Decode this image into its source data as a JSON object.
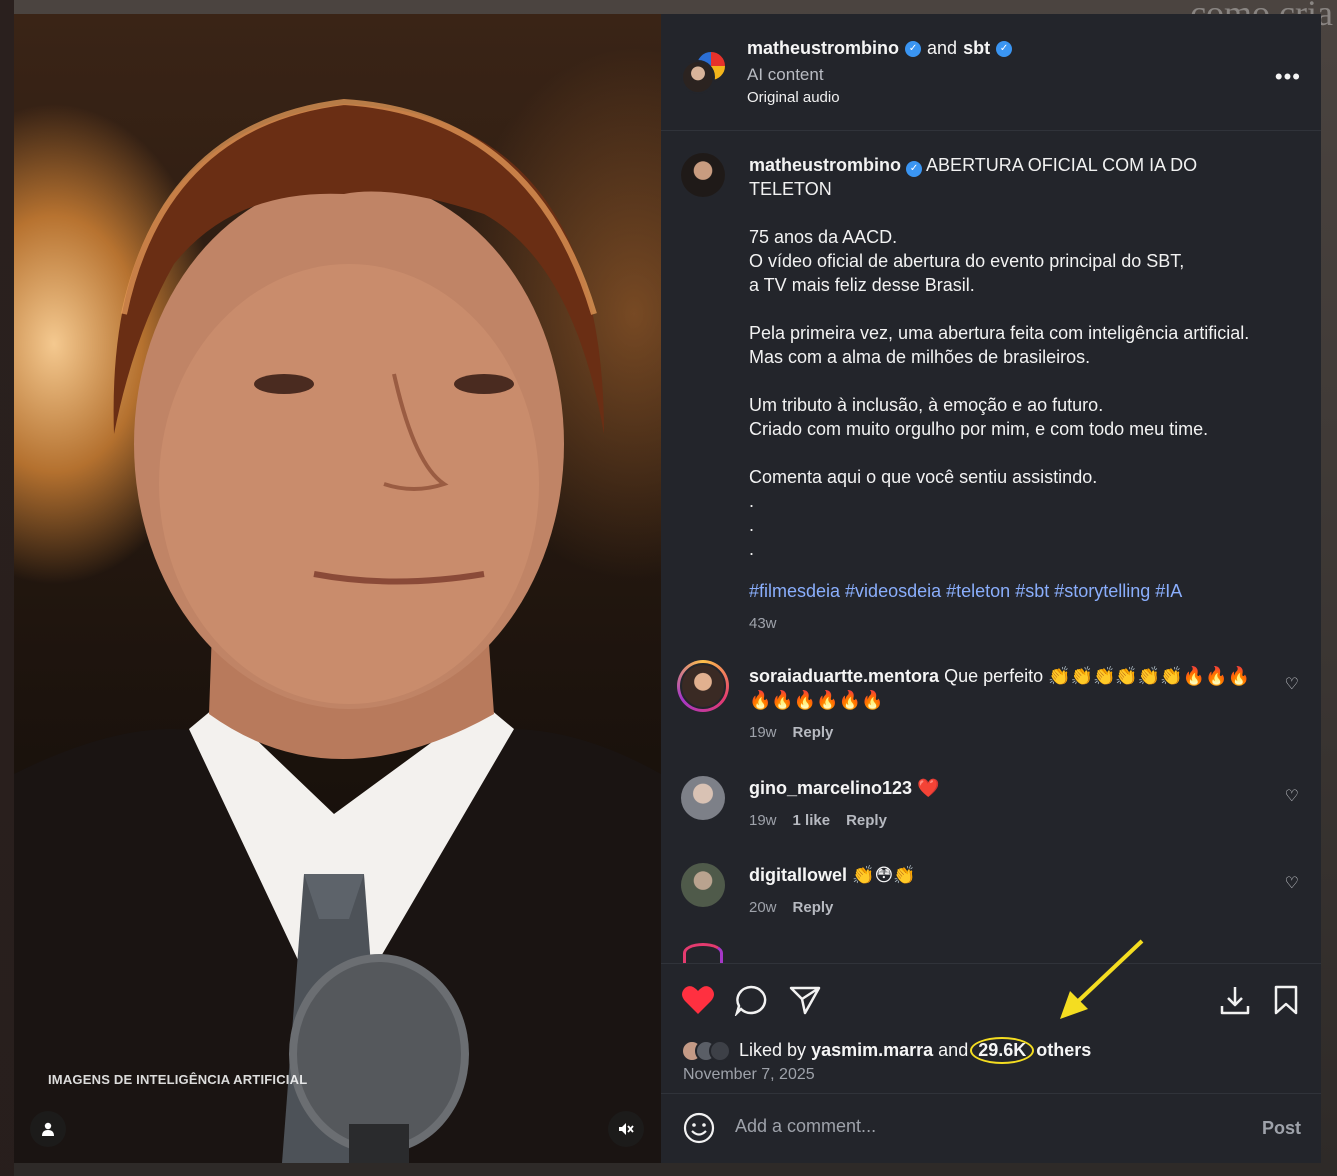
{
  "header": {
    "user1": "matheustrombino",
    "and_text": "and",
    "user2": "sbt",
    "subtitle": "AI content",
    "audio": "Original audio"
  },
  "media": {
    "overlay_text": "IMAGENS DE INTELIGÊNCIA ARTIFICIAL",
    "backdrop_text": "como cria",
    "tag_icon": "person-icon",
    "mute_icon": "speaker-muted-icon"
  },
  "caption": {
    "username": "matheustrombino",
    "title": "ABERTURA OFICIAL COM IA DO TELETON",
    "body": "75 anos da AACD.\nO vídeo oficial de abertura do evento principal do SBT,\na TV mais feliz desse Brasil.\n\nPela primeira vez, uma abertura feita com inteligência artificial.\nMas com a alma de milhões de brasileiros.\n\nUm tributo à inclusão, à emoção e ao futuro.\nCriado com muito orgulho por mim, e com todo meu time.\n\nComenta aqui o que você sentiu assistindo.\n.\n.\n.",
    "hashtags": [
      "#filmesdeia",
      "#videosdeia",
      "#teleton",
      "#sbt",
      "#storytelling",
      "#IA"
    ],
    "time": "43w"
  },
  "comments": [
    {
      "username": "soraiaduartte.mentora",
      "text": "Que perfeito 👏👏👏👏👏👏🔥🔥🔥🔥🔥🔥🔥🔥🔥",
      "time": "19w",
      "likes": "",
      "reply": "Reply"
    },
    {
      "username": "gino_marcelino123",
      "text": "❤️",
      "time": "19w",
      "likes": "1 like",
      "reply": "Reply"
    },
    {
      "username": "digitallowel",
      "text": "👏😳👏",
      "time": "20w",
      "likes": "",
      "reply": "Reply"
    }
  ],
  "likes": {
    "liked_by": "Liked by",
    "user": "yasmim.marra",
    "and": "and",
    "count": "29.6K",
    "others": "others",
    "date": "November 7, 2025"
  },
  "comment_bar": {
    "placeholder": "Add a comment...",
    "post": "Post"
  },
  "colors": {
    "panel_bg": "#23252b",
    "like_red": "#ff3040",
    "hashtag_blue": "#8aaefc",
    "verified_blue": "#3a95f2",
    "annotation_yellow": "#f4dd21"
  }
}
